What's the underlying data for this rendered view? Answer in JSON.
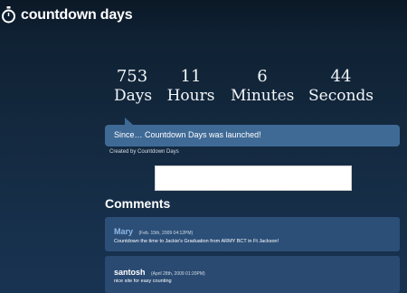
{
  "header": {
    "logo_text": "countdown days",
    "logo_icon": "stopwatch-icon"
  },
  "countdown": [
    {
      "value": "753",
      "unit": "Days"
    },
    {
      "value": "11",
      "unit": "Hours"
    },
    {
      "value": "6",
      "unit": "Minutes"
    },
    {
      "value": "44",
      "unit": "Seconds"
    }
  ],
  "since_message": "Since… Countdown Days was launched!",
  "created_by": "Created by Countdown Days",
  "comments_title": "Comments",
  "comments": [
    {
      "name": "Mary",
      "date": "(Feb. 15th, 2009 04:12PM)",
      "text": "Countdown the time to Jackie's Graduation from ARMY BCT in Ft Jackson!"
    },
    {
      "name": "santosh",
      "date": "(April 28th, 2009 01:20PM)",
      "text": "nice site for easy counting"
    }
  ]
}
